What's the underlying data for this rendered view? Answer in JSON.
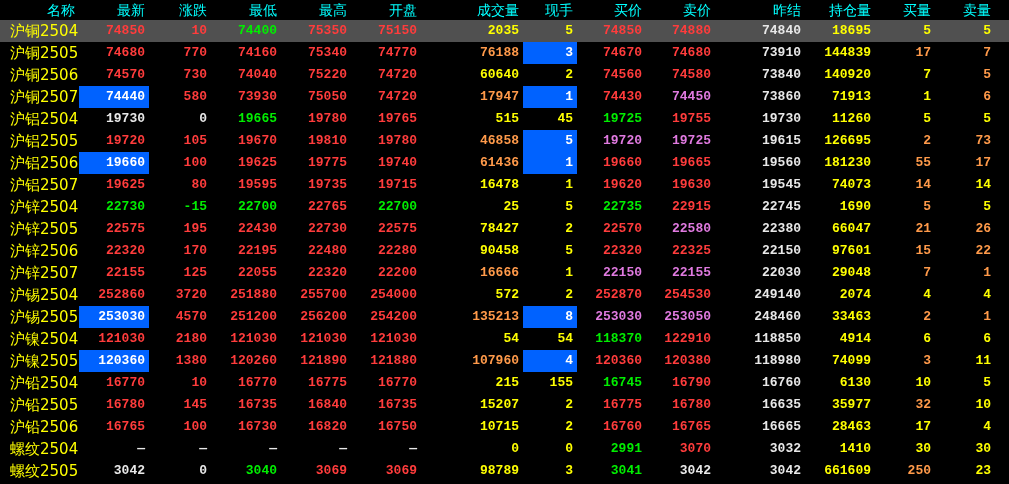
{
  "columns": [
    "名称",
    "最新",
    "涨跌",
    "最低",
    "最高",
    "开盘",
    "成交量",
    "现手",
    "买价",
    "卖价",
    "昨结",
    "持仓量",
    "买量",
    "卖量"
  ],
  "rows": [
    {
      "name": "沪铜2504",
      "selected": true,
      "cells": [
        {
          "text": "74850",
          "color": "#ff3c3c",
          "highlighted": false
        },
        {
          "text": "10",
          "color": "#ff3c3c",
          "highlighted": false
        },
        {
          "text": "74400",
          "color": "#00ee00",
          "highlighted": false
        },
        {
          "text": "75350",
          "color": "#ff3c3c",
          "highlighted": false
        },
        {
          "text": "75150",
          "color": "#ff3c3c",
          "highlighted": false
        },
        {
          "text": "2035",
          "color": "#ffff00",
          "highlighted": false
        },
        {
          "text": "5",
          "color": "#ffff00",
          "highlighted": false
        },
        {
          "text": "74850",
          "color": "#ff3c3c",
          "highlighted": false
        },
        {
          "text": "74880",
          "color": "#ff3c3c",
          "highlighted": false
        },
        {
          "text": "74840",
          "color": "#e8e8e8",
          "highlighted": false
        },
        {
          "text": "18695",
          "color": "#ffff00",
          "highlighted": false
        },
        {
          "text": "5",
          "color": "#ffff00",
          "highlighted": false
        },
        {
          "text": "5",
          "color": "#ffff00",
          "highlighted": false
        }
      ]
    },
    {
      "name": "沪铜2505",
      "selected": false,
      "cells": [
        {
          "text": "74680",
          "color": "#ff3c3c",
          "highlighted": false
        },
        {
          "text": "770",
          "color": "#ff3c3c",
          "highlighted": false
        },
        {
          "text": "74160",
          "color": "#ff3c3c",
          "highlighted": false
        },
        {
          "text": "75340",
          "color": "#ff3c3c",
          "highlighted": false
        },
        {
          "text": "74770",
          "color": "#ff3c3c",
          "highlighted": false
        },
        {
          "text": "76188",
          "color": "#ff9a4a",
          "highlighted": false
        },
        {
          "text": "3",
          "color": "#ffffff",
          "highlighted": true
        },
        {
          "text": "74670",
          "color": "#ff3c3c",
          "highlighted": false
        },
        {
          "text": "74680",
          "color": "#ff3c3c",
          "highlighted": false
        },
        {
          "text": "73910",
          "color": "#e8e8e8",
          "highlighted": false
        },
        {
          "text": "144839",
          "color": "#ffff00",
          "highlighted": false
        },
        {
          "text": "17",
          "color": "#ff9a4a",
          "highlighted": false
        },
        {
          "text": "7",
          "color": "#ff9a4a",
          "highlighted": false
        }
      ]
    },
    {
      "name": "沪铜2506",
      "selected": false,
      "cells": [
        {
          "text": "74570",
          "color": "#ff3c3c",
          "highlighted": false
        },
        {
          "text": "730",
          "color": "#ff3c3c",
          "highlighted": false
        },
        {
          "text": "74040",
          "color": "#ff3c3c",
          "highlighted": false
        },
        {
          "text": "75220",
          "color": "#ff3c3c",
          "highlighted": false
        },
        {
          "text": "74720",
          "color": "#ff3c3c",
          "highlighted": false
        },
        {
          "text": "60640",
          "color": "#ffff00",
          "highlighted": false
        },
        {
          "text": "2",
          "color": "#ffff00",
          "highlighted": false
        },
        {
          "text": "74560",
          "color": "#ff3c3c",
          "highlighted": false
        },
        {
          "text": "74580",
          "color": "#ff3c3c",
          "highlighted": false
        },
        {
          "text": "73840",
          "color": "#e8e8e8",
          "highlighted": false
        },
        {
          "text": "140920",
          "color": "#ffff00",
          "highlighted": false
        },
        {
          "text": "7",
          "color": "#ffff00",
          "highlighted": false
        },
        {
          "text": "5",
          "color": "#ff9a4a",
          "highlighted": false
        }
      ]
    },
    {
      "name": "沪铜2507",
      "selected": false,
      "cells": [
        {
          "text": "74440",
          "color": "#ffffff",
          "highlighted": true
        },
        {
          "text": "580",
          "color": "#ff3c3c",
          "highlighted": false
        },
        {
          "text": "73930",
          "color": "#ff3c3c",
          "highlighted": false
        },
        {
          "text": "75050",
          "color": "#ff3c3c",
          "highlighted": false
        },
        {
          "text": "74720",
          "color": "#ff3c3c",
          "highlighted": false
        },
        {
          "text": "17947",
          "color": "#ff9a4a",
          "highlighted": false
        },
        {
          "text": "1",
          "color": "#ffffff",
          "highlighted": true
        },
        {
          "text": "74430",
          "color": "#ff3c3c",
          "highlighted": false
        },
        {
          "text": "74450",
          "color": "#e07ae0",
          "highlighted": false
        },
        {
          "text": "73860",
          "color": "#e8e8e8",
          "highlighted": false
        },
        {
          "text": "71913",
          "color": "#ffff00",
          "highlighted": false
        },
        {
          "text": "1",
          "color": "#ffff00",
          "highlighted": false
        },
        {
          "text": "6",
          "color": "#ff9a4a",
          "highlighted": false
        }
      ]
    },
    {
      "name": "沪铝2504",
      "selected": false,
      "cells": [
        {
          "text": "19730",
          "color": "#e8e8e8",
          "highlighted": false
        },
        {
          "text": "0",
          "color": "#e8e8e8",
          "highlighted": false
        },
        {
          "text": "19665",
          "color": "#00ee00",
          "highlighted": false
        },
        {
          "text": "19780",
          "color": "#ff3c3c",
          "highlighted": false
        },
        {
          "text": "19765",
          "color": "#ff3c3c",
          "highlighted": false
        },
        {
          "text": "515",
          "color": "#ffff00",
          "highlighted": false
        },
        {
          "text": "45",
          "color": "#ffff00",
          "highlighted": false
        },
        {
          "text": "19725",
          "color": "#00ee00",
          "highlighted": false
        },
        {
          "text": "19755",
          "color": "#ff3c3c",
          "highlighted": false
        },
        {
          "text": "19730",
          "color": "#e8e8e8",
          "highlighted": false
        },
        {
          "text": "11260",
          "color": "#ffff00",
          "highlighted": false
        },
        {
          "text": "5",
          "color": "#ffff00",
          "highlighted": false
        },
        {
          "text": "5",
          "color": "#ffff00",
          "highlighted": false
        }
      ]
    },
    {
      "name": "沪铝2505",
      "selected": false,
      "cells": [
        {
          "text": "19720",
          "color": "#ff3c3c",
          "highlighted": false
        },
        {
          "text": "105",
          "color": "#ff3c3c",
          "highlighted": false
        },
        {
          "text": "19670",
          "color": "#ff3c3c",
          "highlighted": false
        },
        {
          "text": "19810",
          "color": "#ff3c3c",
          "highlighted": false
        },
        {
          "text": "19780",
          "color": "#ff3c3c",
          "highlighted": false
        },
        {
          "text": "46858",
          "color": "#ff9a4a",
          "highlighted": false
        },
        {
          "text": "5",
          "color": "#ffffff",
          "highlighted": true
        },
        {
          "text": "19720",
          "color": "#e07ae0",
          "highlighted": false
        },
        {
          "text": "19725",
          "color": "#e07ae0",
          "highlighted": false
        },
        {
          "text": "19615",
          "color": "#e8e8e8",
          "highlighted": false
        },
        {
          "text": "126695",
          "color": "#ffff00",
          "highlighted": false
        },
        {
          "text": "2",
          "color": "#ff9a4a",
          "highlighted": false
        },
        {
          "text": "73",
          "color": "#ff9a4a",
          "highlighted": false
        }
      ]
    },
    {
      "name": "沪铝2506",
      "selected": false,
      "cells": [
        {
          "text": "19660",
          "color": "#ffffff",
          "highlighted": true
        },
        {
          "text": "100",
          "color": "#ff3c3c",
          "highlighted": false
        },
        {
          "text": "19625",
          "color": "#ff3c3c",
          "highlighted": false
        },
        {
          "text": "19775",
          "color": "#ff3c3c",
          "highlighted": false
        },
        {
          "text": "19740",
          "color": "#ff3c3c",
          "highlighted": false
        },
        {
          "text": "61436",
          "color": "#ff9a4a",
          "highlighted": false
        },
        {
          "text": "1",
          "color": "#ffffff",
          "highlighted": true
        },
        {
          "text": "19660",
          "color": "#ff3c3c",
          "highlighted": false
        },
        {
          "text": "19665",
          "color": "#ff3c3c",
          "highlighted": false
        },
        {
          "text": "19560",
          "color": "#e8e8e8",
          "highlighted": false
        },
        {
          "text": "181230",
          "color": "#ffff00",
          "highlighted": false
        },
        {
          "text": "55",
          "color": "#ff9a4a",
          "highlighted": false
        },
        {
          "text": "17",
          "color": "#ff9a4a",
          "highlighted": false
        }
      ]
    },
    {
      "name": "沪铝2507",
      "selected": false,
      "cells": [
        {
          "text": "19625",
          "color": "#ff3c3c",
          "highlighted": false
        },
        {
          "text": "80",
          "color": "#ff3c3c",
          "highlighted": false
        },
        {
          "text": "19595",
          "color": "#ff3c3c",
          "highlighted": false
        },
        {
          "text": "19735",
          "color": "#ff3c3c",
          "highlighted": false
        },
        {
          "text": "19715",
          "color": "#ff3c3c",
          "highlighted": false
        },
        {
          "text": "16478",
          "color": "#ffff00",
          "highlighted": false
        },
        {
          "text": "1",
          "color": "#ffff00",
          "highlighted": false
        },
        {
          "text": "19620",
          "color": "#ff3c3c",
          "highlighted": false
        },
        {
          "text": "19630",
          "color": "#ff3c3c",
          "highlighted": false
        },
        {
          "text": "19545",
          "color": "#e8e8e8",
          "highlighted": false
        },
        {
          "text": "74073",
          "color": "#ffff00",
          "highlighted": false
        },
        {
          "text": "14",
          "color": "#ff9a4a",
          "highlighted": false
        },
        {
          "text": "14",
          "color": "#ffff00",
          "highlighted": false
        }
      ]
    },
    {
      "name": "沪锌2504",
      "selected": false,
      "cells": [
        {
          "text": "22730",
          "color": "#00ee00",
          "highlighted": false
        },
        {
          "text": "-15",
          "color": "#00ee00",
          "highlighted": false
        },
        {
          "text": "22700",
          "color": "#00ee00",
          "highlighted": false
        },
        {
          "text": "22765",
          "color": "#ff3c3c",
          "highlighted": false
        },
        {
          "text": "22700",
          "color": "#00ee00",
          "highlighted": false
        },
        {
          "text": "25",
          "color": "#ffff00",
          "highlighted": false
        },
        {
          "text": "5",
          "color": "#ffff00",
          "highlighted": false
        },
        {
          "text": "22735",
          "color": "#00ee00",
          "highlighted": false
        },
        {
          "text": "22915",
          "color": "#ff3c3c",
          "highlighted": false
        },
        {
          "text": "22745",
          "color": "#e8e8e8",
          "highlighted": false
        },
        {
          "text": "1690",
          "color": "#ffff00",
          "highlighted": false
        },
        {
          "text": "5",
          "color": "#ff9a4a",
          "highlighted": false
        },
        {
          "text": "5",
          "color": "#ffff00",
          "highlighted": false
        }
      ]
    },
    {
      "name": "沪锌2505",
      "selected": false,
      "cells": [
        {
          "text": "22575",
          "color": "#ff3c3c",
          "highlighted": false
        },
        {
          "text": "195",
          "color": "#ff3c3c",
          "highlighted": false
        },
        {
          "text": "22430",
          "color": "#ff3c3c",
          "highlighted": false
        },
        {
          "text": "22730",
          "color": "#ff3c3c",
          "highlighted": false
        },
        {
          "text": "22575",
          "color": "#ff3c3c",
          "highlighted": false
        },
        {
          "text": "78427",
          "color": "#ffff00",
          "highlighted": false
        },
        {
          "text": "2",
          "color": "#ffff00",
          "highlighted": false
        },
        {
          "text": "22570",
          "color": "#ff3c3c",
          "highlighted": false
        },
        {
          "text": "22580",
          "color": "#e07ae0",
          "highlighted": false
        },
        {
          "text": "22380",
          "color": "#e8e8e8",
          "highlighted": false
        },
        {
          "text": "66047",
          "color": "#ffff00",
          "highlighted": false
        },
        {
          "text": "21",
          "color": "#ff9a4a",
          "highlighted": false
        },
        {
          "text": "26",
          "color": "#ff9a4a",
          "highlighted": false
        }
      ]
    },
    {
      "name": "沪锌2506",
      "selected": false,
      "cells": [
        {
          "text": "22320",
          "color": "#ff3c3c",
          "highlighted": false
        },
        {
          "text": "170",
          "color": "#ff3c3c",
          "highlighted": false
        },
        {
          "text": "22195",
          "color": "#ff3c3c",
          "highlighted": false
        },
        {
          "text": "22480",
          "color": "#ff3c3c",
          "highlighted": false
        },
        {
          "text": "22280",
          "color": "#ff3c3c",
          "highlighted": false
        },
        {
          "text": "90458",
          "color": "#ffff00",
          "highlighted": false
        },
        {
          "text": "5",
          "color": "#ffff00",
          "highlighted": false
        },
        {
          "text": "22320",
          "color": "#ff3c3c",
          "highlighted": false
        },
        {
          "text": "22325",
          "color": "#ff3c3c",
          "highlighted": false
        },
        {
          "text": "22150",
          "color": "#e8e8e8",
          "highlighted": false
        },
        {
          "text": "97601",
          "color": "#ffff00",
          "highlighted": false
        },
        {
          "text": "15",
          "color": "#ff9a4a",
          "highlighted": false
        },
        {
          "text": "22",
          "color": "#ff9a4a",
          "highlighted": false
        }
      ]
    },
    {
      "name": "沪锌2507",
      "selected": false,
      "cells": [
        {
          "text": "22155",
          "color": "#ff3c3c",
          "highlighted": false
        },
        {
          "text": "125",
          "color": "#ff3c3c",
          "highlighted": false
        },
        {
          "text": "22055",
          "color": "#ff3c3c",
          "highlighted": false
        },
        {
          "text": "22320",
          "color": "#ff3c3c",
          "highlighted": false
        },
        {
          "text": "22200",
          "color": "#ff3c3c",
          "highlighted": false
        },
        {
          "text": "16666",
          "color": "#ff9a4a",
          "highlighted": false
        },
        {
          "text": "1",
          "color": "#ffff00",
          "highlighted": false
        },
        {
          "text": "22150",
          "color": "#e07ae0",
          "highlighted": false
        },
        {
          "text": "22155",
          "color": "#e07ae0",
          "highlighted": false
        },
        {
          "text": "22030",
          "color": "#e8e8e8",
          "highlighted": false
        },
        {
          "text": "29048",
          "color": "#ffff00",
          "highlighted": false
        },
        {
          "text": "7",
          "color": "#ff9a4a",
          "highlighted": false
        },
        {
          "text": "1",
          "color": "#ff9a4a",
          "highlighted": false
        }
      ]
    },
    {
      "name": "沪锡2504",
      "selected": false,
      "cells": [
        {
          "text": "252860",
          "color": "#ff3c3c",
          "highlighted": false
        },
        {
          "text": "3720",
          "color": "#ff3c3c",
          "highlighted": false
        },
        {
          "text": "251880",
          "color": "#ff3c3c",
          "highlighted": false
        },
        {
          "text": "255700",
          "color": "#ff3c3c",
          "highlighted": false
        },
        {
          "text": "254000",
          "color": "#ff3c3c",
          "highlighted": false
        },
        {
          "text": "572",
          "color": "#ffff00",
          "highlighted": false
        },
        {
          "text": "2",
          "color": "#ffff00",
          "highlighted": false
        },
        {
          "text": "252870",
          "color": "#ff3c3c",
          "highlighted": false
        },
        {
          "text": "254530",
          "color": "#ff3c3c",
          "highlighted": false
        },
        {
          "text": "249140",
          "color": "#e8e8e8",
          "highlighted": false
        },
        {
          "text": "2074",
          "color": "#ffff00",
          "highlighted": false
        },
        {
          "text": "4",
          "color": "#ffff00",
          "highlighted": false
        },
        {
          "text": "4",
          "color": "#ffff00",
          "highlighted": false
        }
      ]
    },
    {
      "name": "沪锡2505",
      "selected": false,
      "cells": [
        {
          "text": "253030",
          "color": "#ffffff",
          "highlighted": true
        },
        {
          "text": "4570",
          "color": "#ff3c3c",
          "highlighted": false
        },
        {
          "text": "251200",
          "color": "#ff3c3c",
          "highlighted": false
        },
        {
          "text": "256200",
          "color": "#ff3c3c",
          "highlighted": false
        },
        {
          "text": "254200",
          "color": "#ff3c3c",
          "highlighted": false
        },
        {
          "text": "135213",
          "color": "#ff9a4a",
          "highlighted": false
        },
        {
          "text": "8",
          "color": "#ffffff",
          "highlighted": true
        },
        {
          "text": "253030",
          "color": "#e07ae0",
          "highlighted": false
        },
        {
          "text": "253050",
          "color": "#e07ae0",
          "highlighted": false
        },
        {
          "text": "248460",
          "color": "#e8e8e8",
          "highlighted": false
        },
        {
          "text": "33463",
          "color": "#ffff00",
          "highlighted": false
        },
        {
          "text": "2",
          "color": "#ff9a4a",
          "highlighted": false
        },
        {
          "text": "1",
          "color": "#ff9a4a",
          "highlighted": false
        }
      ]
    },
    {
      "name": "沪镍2504",
      "selected": false,
      "cells": [
        {
          "text": "121030",
          "color": "#ff3c3c",
          "highlighted": false
        },
        {
          "text": "2180",
          "color": "#ff3c3c",
          "highlighted": false
        },
        {
          "text": "121030",
          "color": "#ff3c3c",
          "highlighted": false
        },
        {
          "text": "121030",
          "color": "#ff3c3c",
          "highlighted": false
        },
        {
          "text": "121030",
          "color": "#ff3c3c",
          "highlighted": false
        },
        {
          "text": "54",
          "color": "#ffff00",
          "highlighted": false
        },
        {
          "text": "54",
          "color": "#ffff00",
          "highlighted": false
        },
        {
          "text": "118370",
          "color": "#00ee00",
          "highlighted": false
        },
        {
          "text": "122910",
          "color": "#ff3c3c",
          "highlighted": false
        },
        {
          "text": "118850",
          "color": "#e8e8e8",
          "highlighted": false
        },
        {
          "text": "4914",
          "color": "#ffff00",
          "highlighted": false
        },
        {
          "text": "6",
          "color": "#ffff00",
          "highlighted": false
        },
        {
          "text": "6",
          "color": "#ffff00",
          "highlighted": false
        }
      ]
    },
    {
      "name": "沪镍2505",
      "selected": false,
      "cells": [
        {
          "text": "120360",
          "color": "#ffffff",
          "highlighted": true
        },
        {
          "text": "1380",
          "color": "#ff3c3c",
          "highlighted": false
        },
        {
          "text": "120260",
          "color": "#ff3c3c",
          "highlighted": false
        },
        {
          "text": "121890",
          "color": "#ff3c3c",
          "highlighted": false
        },
        {
          "text": "121880",
          "color": "#ff3c3c",
          "highlighted": false
        },
        {
          "text": "107960",
          "color": "#ff9a4a",
          "highlighted": false
        },
        {
          "text": "4",
          "color": "#ffffff",
          "highlighted": true
        },
        {
          "text": "120360",
          "color": "#ff3c3c",
          "highlighted": false
        },
        {
          "text": "120380",
          "color": "#ff3c3c",
          "highlighted": false
        },
        {
          "text": "118980",
          "color": "#e8e8e8",
          "highlighted": false
        },
        {
          "text": "74099",
          "color": "#ffff00",
          "highlighted": false
        },
        {
          "text": "3",
          "color": "#ff9a4a",
          "highlighted": false
        },
        {
          "text": "11",
          "color": "#ffff00",
          "highlighted": false
        }
      ]
    },
    {
      "name": "沪铅2504",
      "selected": false,
      "cells": [
        {
          "text": "16770",
          "color": "#ff3c3c",
          "highlighted": false
        },
        {
          "text": "10",
          "color": "#ff3c3c",
          "highlighted": false
        },
        {
          "text": "16770",
          "color": "#ff3c3c",
          "highlighted": false
        },
        {
          "text": "16775",
          "color": "#ff3c3c",
          "highlighted": false
        },
        {
          "text": "16770",
          "color": "#ff3c3c",
          "highlighted": false
        },
        {
          "text": "215",
          "color": "#ffff00",
          "highlighted": false
        },
        {
          "text": "155",
          "color": "#ffff00",
          "highlighted": false
        },
        {
          "text": "16745",
          "color": "#00ee00",
          "highlighted": false
        },
        {
          "text": "16790",
          "color": "#ff3c3c",
          "highlighted": false
        },
        {
          "text": "16760",
          "color": "#e8e8e8",
          "highlighted": false
        },
        {
          "text": "6130",
          "color": "#ffff00",
          "highlighted": false
        },
        {
          "text": "10",
          "color": "#ffff00",
          "highlighted": false
        },
        {
          "text": "5",
          "color": "#ffff00",
          "highlighted": false
        }
      ]
    },
    {
      "name": "沪铅2505",
      "selected": false,
      "cells": [
        {
          "text": "16780",
          "color": "#ff3c3c",
          "highlighted": false
        },
        {
          "text": "145",
          "color": "#ff3c3c",
          "highlighted": false
        },
        {
          "text": "16735",
          "color": "#ff3c3c",
          "highlighted": false
        },
        {
          "text": "16840",
          "color": "#ff3c3c",
          "highlighted": false
        },
        {
          "text": "16735",
          "color": "#ff3c3c",
          "highlighted": false
        },
        {
          "text": "15207",
          "color": "#ffff00",
          "highlighted": false
        },
        {
          "text": "2",
          "color": "#ffff00",
          "highlighted": false
        },
        {
          "text": "16775",
          "color": "#ff3c3c",
          "highlighted": false
        },
        {
          "text": "16780",
          "color": "#ff3c3c",
          "highlighted": false
        },
        {
          "text": "16635",
          "color": "#e8e8e8",
          "highlighted": false
        },
        {
          "text": "35977",
          "color": "#ffff00",
          "highlighted": false
        },
        {
          "text": "32",
          "color": "#ff9a4a",
          "highlighted": false
        },
        {
          "text": "10",
          "color": "#ffff00",
          "highlighted": false
        }
      ]
    },
    {
      "name": "沪铅2506",
      "selected": false,
      "cells": [
        {
          "text": "16765",
          "color": "#ff3c3c",
          "highlighted": false
        },
        {
          "text": "100",
          "color": "#ff3c3c",
          "highlighted": false
        },
        {
          "text": "16730",
          "color": "#ff3c3c",
          "highlighted": false
        },
        {
          "text": "16820",
          "color": "#ff3c3c",
          "highlighted": false
        },
        {
          "text": "16750",
          "color": "#ff3c3c",
          "highlighted": false
        },
        {
          "text": "10715",
          "color": "#ffff00",
          "highlighted": false
        },
        {
          "text": "2",
          "color": "#ffff00",
          "highlighted": false
        },
        {
          "text": "16760",
          "color": "#ff3c3c",
          "highlighted": false
        },
        {
          "text": "16765",
          "color": "#ff3c3c",
          "highlighted": false
        },
        {
          "text": "16665",
          "color": "#e8e8e8",
          "highlighted": false
        },
        {
          "text": "28463",
          "color": "#ffff00",
          "highlighted": false
        },
        {
          "text": "17",
          "color": "#ffff00",
          "highlighted": false
        },
        {
          "text": "4",
          "color": "#ffff00",
          "highlighted": false
        }
      ]
    },
    {
      "name": "螺纹2504",
      "selected": false,
      "cells": [
        {
          "text": "—",
          "color": "#e8e8e8",
          "highlighted": false
        },
        {
          "text": "—",
          "color": "#e8e8e8",
          "highlighted": false
        },
        {
          "text": "—",
          "color": "#e8e8e8",
          "highlighted": false
        },
        {
          "text": "—",
          "color": "#e8e8e8",
          "highlighted": false
        },
        {
          "text": "—",
          "color": "#e8e8e8",
          "highlighted": false
        },
        {
          "text": "0",
          "color": "#ffff00",
          "highlighted": false
        },
        {
          "text": "0",
          "color": "#ffff00",
          "highlighted": false
        },
        {
          "text": "2991",
          "color": "#00ee00",
          "highlighted": false
        },
        {
          "text": "3070",
          "color": "#ff3c3c",
          "highlighted": false
        },
        {
          "text": "3032",
          "color": "#e8e8e8",
          "highlighted": false
        },
        {
          "text": "1410",
          "color": "#ffff00",
          "highlighted": false
        },
        {
          "text": "30",
          "color": "#ffff00",
          "highlighted": false
        },
        {
          "text": "30",
          "color": "#ffff00",
          "highlighted": false
        }
      ]
    },
    {
      "name": "螺纹2505",
      "selected": false,
      "cells": [
        {
          "text": "3042",
          "color": "#e8e8e8",
          "highlighted": false
        },
        {
          "text": "0",
          "color": "#e8e8e8",
          "highlighted": false
        },
        {
          "text": "3040",
          "color": "#00ee00",
          "highlighted": false
        },
        {
          "text": "3069",
          "color": "#ff3c3c",
          "highlighted": false
        },
        {
          "text": "3069",
          "color": "#ff3c3c",
          "highlighted": false
        },
        {
          "text": "98789",
          "color": "#ffff00",
          "highlighted": false
        },
        {
          "text": "3",
          "color": "#ffff00",
          "highlighted": false
        },
        {
          "text": "3041",
          "color": "#00ee00",
          "highlighted": false
        },
        {
          "text": "3042",
          "color": "#e8e8e8",
          "highlighted": false
        },
        {
          "text": "3042",
          "color": "#e8e8e8",
          "highlighted": false
        },
        {
          "text": "661609",
          "color": "#ffff00",
          "highlighted": false
        },
        {
          "text": "250",
          "color": "#ff9a4a",
          "highlighted": false
        },
        {
          "text": "23",
          "color": "#ffff00",
          "highlighted": false
        }
      ]
    }
  ]
}
